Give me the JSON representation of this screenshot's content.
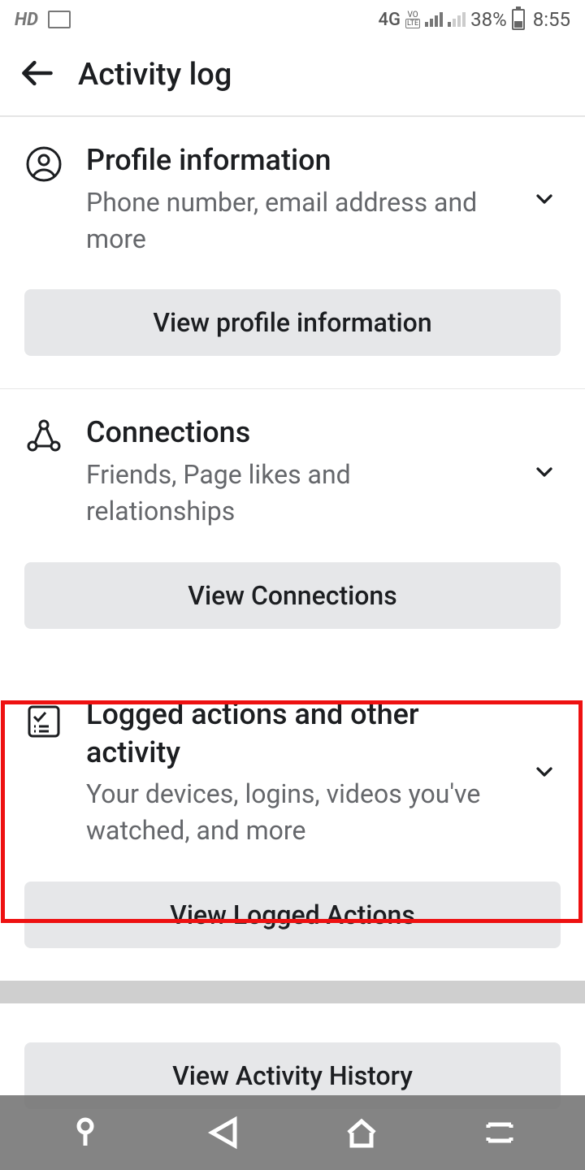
{
  "status": {
    "hd": "HD",
    "network": "4G",
    "battery_pct": "38%",
    "time": "8:55"
  },
  "header": {
    "title": "Activity log"
  },
  "sections": [
    {
      "title": "Profile information",
      "subtitle": "Phone number, email address and more",
      "button": "View profile information"
    },
    {
      "title": "Connections",
      "subtitle": "Friends, Page likes and relationships",
      "button": "View Connections"
    },
    {
      "title": "Logged actions and other activity",
      "subtitle": "Your devices, logins, videos you've watched, and more",
      "button": "View Logged Actions"
    }
  ],
  "footer_button": "View Activity History"
}
